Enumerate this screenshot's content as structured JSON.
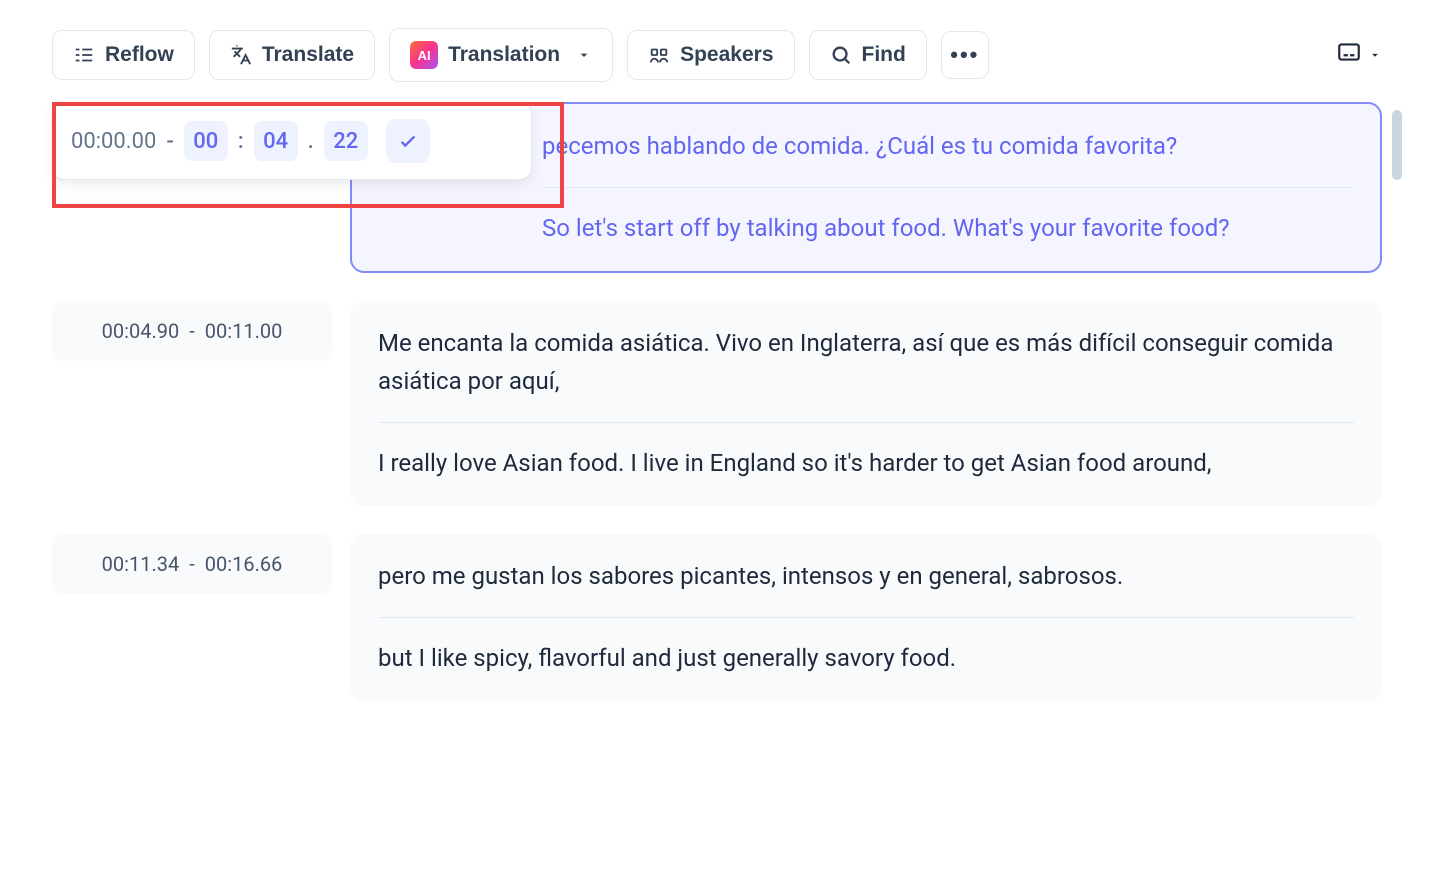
{
  "toolbar": {
    "reflow": "Reflow",
    "translate": "Translate",
    "translation": "Translation",
    "speakers": "Speakers",
    "find": "Find",
    "ai_badge": "AI"
  },
  "editor": {
    "start_time": "00:00.00",
    "dash": "-",
    "end_min": "00",
    "colon": ":",
    "end_sec": "04",
    "dot": ".",
    "end_ms": "22"
  },
  "segments": [
    {
      "start": "00:00.00",
      "end": "00:04.22",
      "active": true,
      "source": "pecemos hablando de comida. ¿Cuál es tu comida favorita?",
      "translation": "So let's start off by talking about food. What's your favorite food?"
    },
    {
      "start": "00:04.90",
      "end": "00:11.00",
      "active": false,
      "source": "Me encanta la comida asiática. Vivo en Inglaterra, así que es más difícil conseguir comida asiática por aquí,",
      "translation": "I really love Asian food. I live in England so it's harder to get Asian food around,"
    },
    {
      "start": "00:11.34",
      "end": "00:16.66",
      "active": false,
      "source": "pero me gustan los sabores picantes, intensos y en general, sabrosos.",
      "translation": "but I like spicy, flavorful and just generally savory food."
    }
  ]
}
